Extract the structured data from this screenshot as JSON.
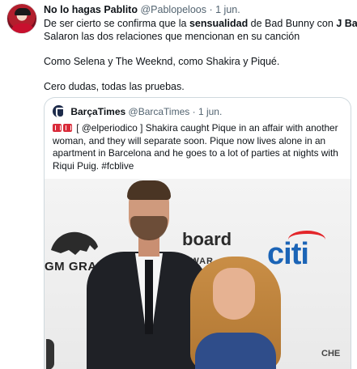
{
  "tweet": {
    "author_name": "No lo hagas Pablito",
    "author_handle": "@Pablopeloos",
    "separator": "·",
    "time": "1 jun.",
    "line1_pre": "De ser cierto se confirma que la ",
    "line1_bold1": "sensualidad",
    "line1_mid": " de Bad Bunny con ",
    "line1_bold2": "J Balvin",
    "line2": "Salaron las dos relaciones que mencionan  en su canción",
    "line3": "Como Selena y The Weeknd, como Shakira y Piqué.",
    "line4": "Cero dudas, todas las pruebas."
  },
  "quote": {
    "name": "BarçaTimes",
    "handle": "@BarcaTimes",
    "separator": "·",
    "time": "1 jun.",
    "line1": " [ @elperiodico ] Shakira caught Pique in an affair with another",
    "line2": "woman, and they will separate soon. Pique now lives alone in an",
    "line3": "apartment in Barcelona and he goes to a lot of parties at nights with",
    "line4": "Riqui Puig. #fcblive"
  },
  "photo": {
    "sign_mgm": "GM GRAN",
    "sign_board": "board",
    "sign_awards": "AWAR",
    "sign_citi": "citi",
    "sign_chev": "CHE"
  }
}
